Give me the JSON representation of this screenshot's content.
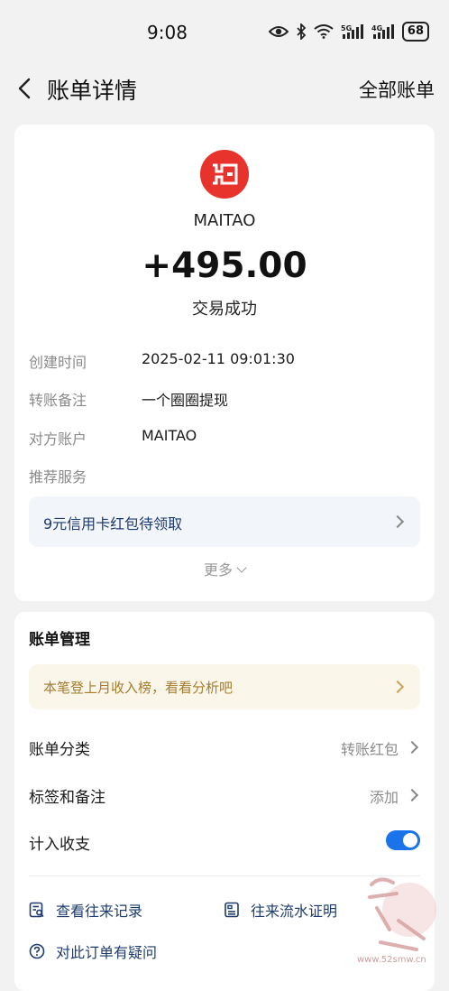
{
  "status_bar": {
    "time": "9:08",
    "battery": "68",
    "icons": [
      "eye-icon",
      "bluetooth-icon",
      "wifi-icon",
      "signal-5g-icon",
      "signal-4g-icon",
      "battery-icon"
    ]
  },
  "nav": {
    "title": "账单详情",
    "right_link": "全部账单"
  },
  "summary": {
    "merchant": "MAITAO",
    "amount": "+495.00",
    "status": "交易成功",
    "logo_color": "#e8332c"
  },
  "details": [
    {
      "label": "创建时间",
      "value": "2025-02-11 09:01:30"
    },
    {
      "label": "转账备注",
      "value": "一个圈圈提现"
    },
    {
      "label": "对方账户",
      "value": "MAITAO"
    },
    {
      "label": "推荐服务",
      "value": ""
    }
  ],
  "promo": {
    "text": "9元信用卡红包待领取"
  },
  "more": {
    "label": "更多"
  },
  "management": {
    "title": "账单管理",
    "tip": "本笔登上月收入榜，看看分析吧",
    "category_label": "账单分类",
    "category_value": "转账红包",
    "tags_label": "标签和备注",
    "tags_value": "添加",
    "count_label": "计入收支",
    "count_enabled": true,
    "accent_color": "#1a73e8"
  },
  "links": {
    "history": "查看往来记录",
    "proof": "往来流水证明",
    "question": "对此订单有疑问"
  },
  "watermark": {
    "url": "www.52smw.cn"
  }
}
